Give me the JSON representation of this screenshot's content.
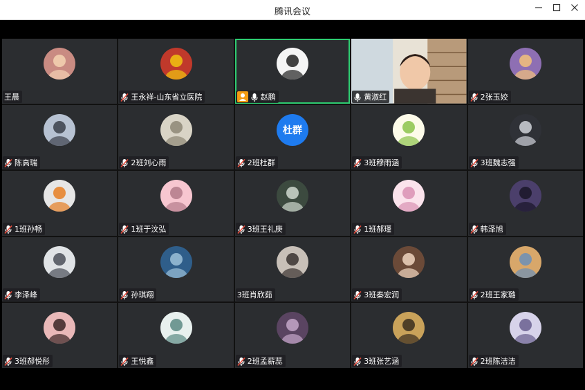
{
  "window": {
    "title": "腾讯会议",
    "minimize_icon": "minimize-icon",
    "maximize_icon": "maximize-icon",
    "close_icon": "close-icon"
  },
  "colors": {
    "tile_bg": "#2b2d30",
    "active_border": "#2ecc71",
    "host_badge": "#f39c12",
    "mic_muted": "#e74c3c"
  },
  "participants": [
    {
      "name": "王晨",
      "mic": "none",
      "avatar": "bear",
      "c1": "#c98b82",
      "c2": "#f5d3b3"
    },
    {
      "name": "王永祥-山东省立医院",
      "mic": "muted",
      "avatar": "tiger",
      "c1": "#c0392b",
      "c2": "#f1c40f"
    },
    {
      "name": "赵鹏",
      "mic": "on",
      "host": true,
      "active": true,
      "avatar": "dog",
      "c1": "#f5f5f5",
      "c2": "#222222"
    },
    {
      "name": "黄淑红",
      "mic": "on",
      "video": true,
      "avatar": "video",
      "c1": "#d7c3a8",
      "c2": "#8a6d52"
    },
    {
      "name": "2张玉姣",
      "mic": "muted",
      "avatar": "girl",
      "c1": "#8e6fb3",
      "c2": "#f3c27a"
    },
    {
      "name": "陈高瑞",
      "mic": "muted",
      "avatar": "scene",
      "c1": "#b7c2d2",
      "c2": "#3b3f4a"
    },
    {
      "name": "2班刘心雨",
      "mic": "muted",
      "avatar": "sketch",
      "c1": "#d9d4c6",
      "c2": "#8d8775"
    },
    {
      "name": "2班杜群",
      "mic": "muted",
      "avatar": "text",
      "text": "杜群",
      "c1": "#1e7bef",
      "c2": "#1e7bef"
    },
    {
      "name": "3班穆雨涵",
      "mic": "muted",
      "avatar": "cute",
      "c1": "#fdfbe9",
      "c2": "#8bc34a"
    },
    {
      "name": "3班魏志强",
      "mic": "muted",
      "avatar": "hand",
      "c1": "#2f3137",
      "c2": "#cfd2d8"
    },
    {
      "name": "1班孙畅",
      "mic": "muted",
      "avatar": "anime",
      "c1": "#e6e6e6",
      "c2": "#e67e22"
    },
    {
      "name": "1班于汶弘",
      "mic": "muted",
      "avatar": "pink",
      "c1": "#f7c6d0",
      "c2": "#b37a8a"
    },
    {
      "name": "3班王礼庚",
      "mic": "muted",
      "avatar": "dark",
      "c1": "#3c4a3f",
      "c2": "#cfd8cf"
    },
    {
      "name": "1班郝瑾",
      "mic": "muted",
      "avatar": "pink2",
      "c1": "#fbe3ec",
      "c2": "#d991b4"
    },
    {
      "name": "韩泽旭",
      "mic": "muted",
      "avatar": "silhouette",
      "c1": "#4b3f6b",
      "c2": "#1a1628"
    },
    {
      "name": "李泽峰",
      "mic": "muted",
      "avatar": "boy",
      "c1": "#e0e3e6",
      "c2": "#4a4f58"
    },
    {
      "name": "孙琪翔",
      "mic": "muted",
      "avatar": "blue",
      "c1": "#2f5e8a",
      "c2": "#9cc1d8"
    },
    {
      "name": "3班肖欣茹",
      "mic": "none",
      "avatar": "girl2",
      "c1": "#c8c0b8",
      "c2": "#3a3330"
    },
    {
      "name": "3班秦宏润",
      "mic": "muted",
      "avatar": "anime2",
      "c1": "#6b4a38",
      "c2": "#f0d5c0"
    },
    {
      "name": "2班王家璐",
      "mic": "muted",
      "avatar": "art",
      "c1": "#d8a76a",
      "c2": "#6b8fb8"
    },
    {
      "name": "3班郝悦彤",
      "mic": "muted",
      "avatar": "lady",
      "c1": "#e9b8b8",
      "c2": "#3a2525"
    },
    {
      "name": "王悦鑫",
      "mic": "muted",
      "avatar": "anime3",
      "c1": "#e8f0ee",
      "c2": "#5c8a84"
    },
    {
      "name": "2班孟薪蕊",
      "mic": "muted",
      "avatar": "purple",
      "c1": "#5a4461",
      "c2": "#c4a7c9"
    },
    {
      "name": "3班张艺涵",
      "mic": "muted",
      "avatar": "gold",
      "c1": "#c9a25a",
      "c2": "#3a2e1f"
    },
    {
      "name": "2班陈洁洁",
      "mic": "muted",
      "avatar": "anime4",
      "c1": "#d7d3ea",
      "c2": "#6a5f8f"
    }
  ]
}
